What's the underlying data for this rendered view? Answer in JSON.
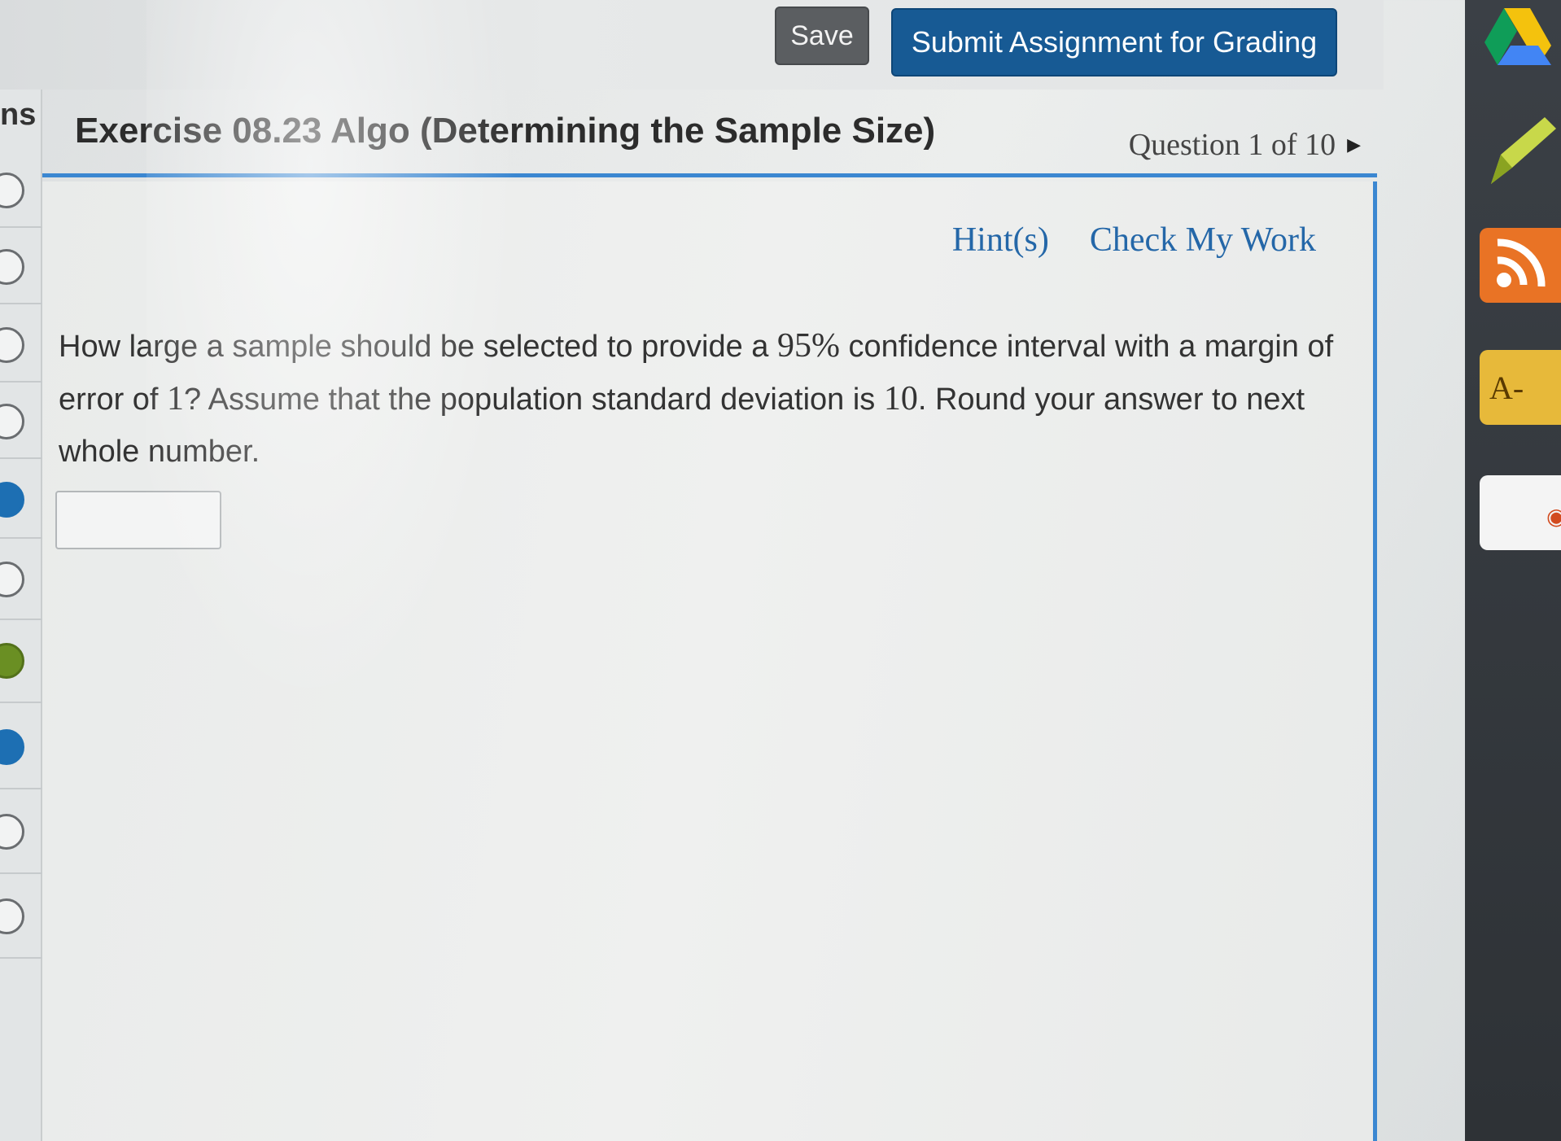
{
  "toolbar": {
    "save_label": "Save",
    "submit_label": "Submit Assignment for Grading"
  },
  "sidebar": {
    "label": "ns"
  },
  "exercise": {
    "title": "Exercise 08.23 Algo (Determining the Sample Size)",
    "question_position": "Question 1 of 10"
  },
  "panel": {
    "hint_label": "Hint(s)",
    "check_label": "Check My Work",
    "question_part1": "How large a sample should be selected to provide a ",
    "confidence": "95%",
    "question_part2": " confidence interval with a margin of error of ",
    "margin": "1",
    "question_part3": "? Assume that the population standard deviation is ",
    "std_dev": "10",
    "question_part4": ". Round your answer to next whole number.",
    "answer_value": ""
  },
  "extensions": {
    "font_label": "A-"
  },
  "colors": {
    "accent": "#3b87d1",
    "submit_bg": "#175a94",
    "save_bg": "#5b5e61",
    "link": "#2467a8"
  }
}
